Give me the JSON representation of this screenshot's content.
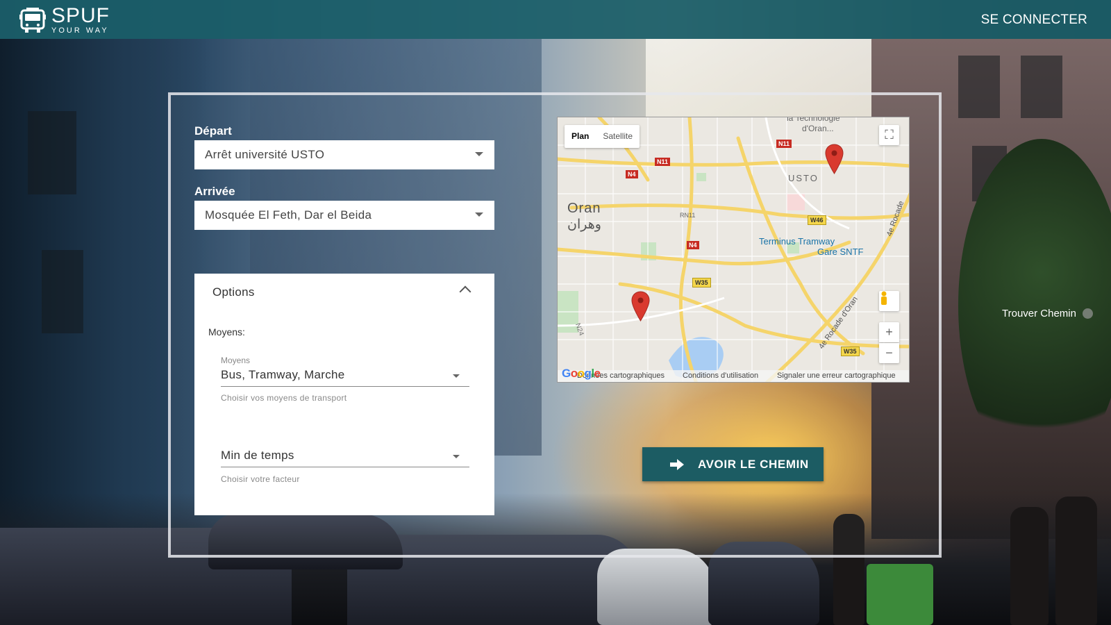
{
  "header": {
    "brand": "SPUF",
    "tagline": "YOUR WAY",
    "login_label": "SE CONNECTER",
    "logo_icon": "bus-icon"
  },
  "form": {
    "depart_label": "Départ",
    "depart_value": "Arrêt université USTO",
    "arrivee_label": "Arrivée",
    "arrivee_value": "Mosquée El Feth, Dar el Beida"
  },
  "options": {
    "title": "Options",
    "moyens_title": "Moyens:",
    "moyens_float_label": "Moyens",
    "moyens_value": "Bus, Tramway, Marche",
    "moyens_help": "Choisir vos moyens de transport",
    "facteur_value": "Min de temps",
    "facteur_help": "Choisir votre facteur"
  },
  "map": {
    "type_plan": "Plan",
    "type_satellite": "Satellite",
    "city_name": "Oran",
    "city_name_ar": "وهران",
    "district": "USTO",
    "poi_tech_1": "la Technologie",
    "poi_tech_2": "d'Oran...",
    "poi_tram": "Terminus Tramway",
    "poi_gare": "Gare SNTF",
    "road_rocade": "4e Rocade d'Oran",
    "road_rocade_2": "4e Rocade",
    "road_n24": "N24",
    "road_rn11": "RN11",
    "badges": {
      "n11_a": "N11",
      "n11_b": "N11",
      "n4_a": "N4",
      "n4_b": "N4",
      "w46": "W46",
      "w35_a": "W35",
      "w35_b": "W35"
    },
    "google_logo": "Google",
    "foot_data": "Données cartographiques",
    "foot_terms": "Conditions d'utilisation",
    "foot_report": "Signaler une erreur cartographique",
    "zoom_in": "+",
    "zoom_out": "−"
  },
  "action": {
    "label": "AVOIR LE CHEMIN"
  },
  "side": {
    "label": "Trouver Chemin"
  },
  "colors": {
    "header": "#1a5e68",
    "button": "#1c5c63",
    "pin": "#d93a2f"
  }
}
